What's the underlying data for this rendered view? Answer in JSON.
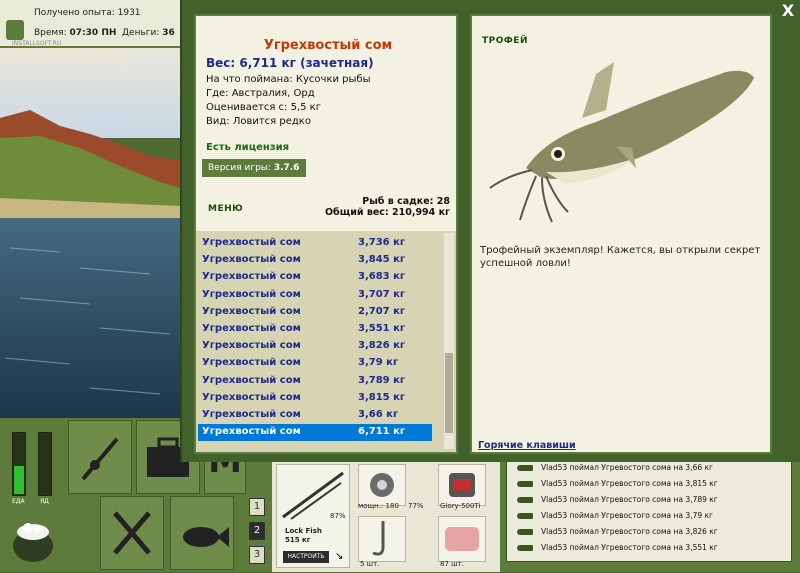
{
  "status": {
    "xp_label": "Получено опыта:",
    "xp_value": "1931",
    "time_label": "Время:",
    "time_value": "07:30 ПН",
    "money_label": "Деньги:",
    "money_value": "36",
    "watermark": "INSTALLSOFT.RU"
  },
  "hud": {
    "food_label": "ЕДА",
    "poison_label": "ЯД",
    "food_level_pct": 45,
    "poison_level_pct": 0,
    "tab_numbers": [
      "1",
      "2",
      "3"
    ],
    "active_tab": "2"
  },
  "gear": {
    "rod_name": "Lock Fish",
    "rod_weight": "515 кг",
    "rod_pct": "87%",
    "configure_label": "НАСТРОИТЬ",
    "reel_label": "мощн.: 180",
    "reel_pct": "77%",
    "line_label": "Glory-500Ti",
    "hook_count": "5 шт.",
    "bait_count": "87 шт."
  },
  "chat": {
    "messages": [
      "Vlad53 поймал Угревостого сома на 3,66 кг",
      "Vlad53 поймал Угревостого сома на 3,815 кг",
      "Vlad53 поймал Угревостого сома на 3,789 кг",
      "Vlad53 поймал Угревостого сома на 3,79 кг",
      "Vlad53 поймал Угревостого сома на 3,826 кг",
      "Vlad53 поймал Угревостого сома на 3,551 кг"
    ]
  },
  "modal": {
    "close_label": "X",
    "fish_name": "Угрехвостый сом",
    "weight_line": "Вес: 6,711 кг (зачетная)",
    "caught_with": "На что поймана: Кусочки рыбы",
    "where": "Где: Австралия, Орд",
    "valued_from": "Оценивается с: 5,5 кг",
    "kind": "Вид: Ловится редко",
    "license": "Есть лицензия",
    "version_label": "Версия игры:",
    "version_value": "3.7.6",
    "menu_label": "МЕНЮ",
    "fish_in_cage": "Рыб в садке: 28",
    "total_weight": "Общий вес: 210,994 кг",
    "catch_list": [
      {
        "name": "Угрехвостый сом",
        "weight": "3,736 кг"
      },
      {
        "name": "Угрехвостый сом",
        "weight": "3,845 кг"
      },
      {
        "name": "Угрехвостый сом",
        "weight": "3,683 кг"
      },
      {
        "name": "Угрехвостый сом",
        "weight": "3,707 кг"
      },
      {
        "name": "Угрехвостый сом",
        "weight": "2,707 кг"
      },
      {
        "name": "Угрехвостый сом",
        "weight": "3,551 кг"
      },
      {
        "name": "Угрехвостый сом",
        "weight": "3,826 кг"
      },
      {
        "name": "Угрехвостый сом",
        "weight": "3,79 кг"
      },
      {
        "name": "Угрехвостый сом",
        "weight": "3,789 кг"
      },
      {
        "name": "Угрехвостый сом",
        "weight": "3,815 кг"
      },
      {
        "name": "Угрехвостый сом",
        "weight": "3,66 кг"
      },
      {
        "name": "Угрехвостый сом",
        "weight": "6,711 кг"
      }
    ],
    "selected_index": 11,
    "trophy_title": "ТРОФЕЙ",
    "trophy_text": "Трофейный экземпляр! Кажется, вы открыли секрет успешной ловли!",
    "hotkeys_link": "Горячие клавиши"
  },
  "colors": {
    "frame_green": "#5d7b3b",
    "panel_bg": "#f3f2e2",
    "fish_name": "#c23a07",
    "list_text": "#1c2a8a",
    "selection": "#0078d7"
  }
}
